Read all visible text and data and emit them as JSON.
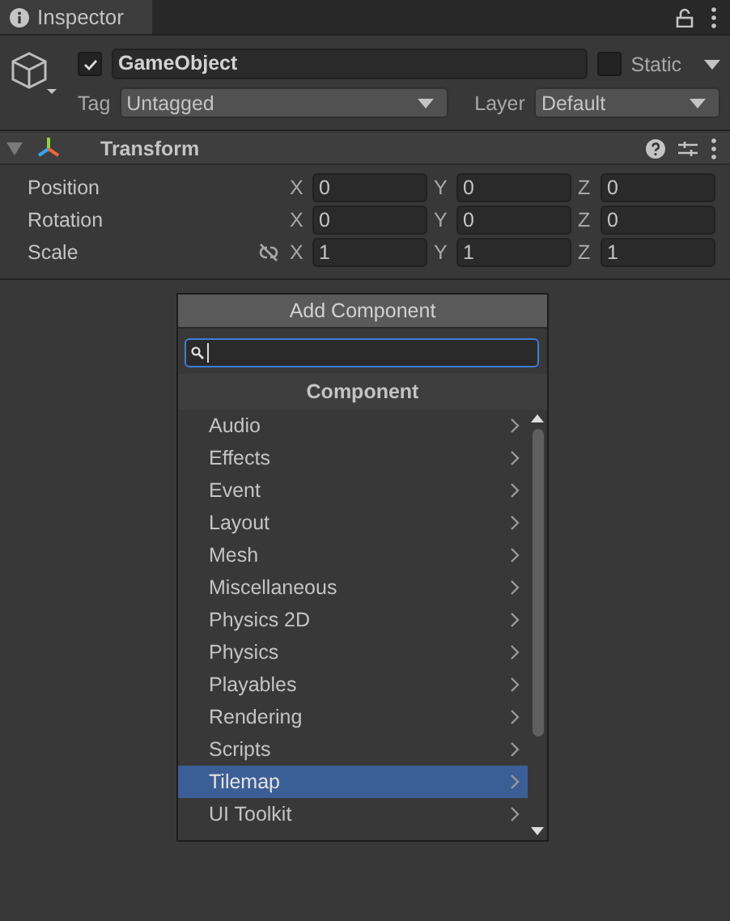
{
  "tabs": [
    {
      "label": "Inspector",
      "selected": true
    }
  ],
  "object": {
    "active": true,
    "name": "GameObject",
    "static": false,
    "static_label": "Static",
    "tag_label": "Tag",
    "tag": "Untagged",
    "layer_label": "Layer",
    "layer": "Default"
  },
  "transform": {
    "title": "Transform",
    "expanded": true,
    "rows": [
      {
        "label": "Position",
        "kind": "plain",
        "fields": [
          {
            "axis": "X",
            "value": "0"
          },
          {
            "axis": "Y",
            "value": "0"
          },
          {
            "axis": "Z",
            "value": "0"
          }
        ]
      },
      {
        "label": "Rotation",
        "kind": "plain",
        "fields": [
          {
            "axis": "X",
            "value": "0"
          },
          {
            "axis": "Y",
            "value": "0"
          },
          {
            "axis": "Z",
            "value": "0"
          }
        ]
      },
      {
        "label": "Scale",
        "kind": "linkable",
        "fields": [
          {
            "axis": "X",
            "value": "1"
          },
          {
            "axis": "Y",
            "value": "1"
          },
          {
            "axis": "Z",
            "value": "1"
          }
        ]
      }
    ]
  },
  "add_component": {
    "button": "Add Component",
    "header": "Component",
    "items": [
      {
        "label": "Audio",
        "selected": false
      },
      {
        "label": "Effects",
        "selected": false
      },
      {
        "label": "Event",
        "selected": false
      },
      {
        "label": "Layout",
        "selected": false
      },
      {
        "label": "Mesh",
        "selected": false
      },
      {
        "label": "Miscellaneous",
        "selected": false
      },
      {
        "label": "Physics 2D",
        "selected": false
      },
      {
        "label": "Physics",
        "selected": false
      },
      {
        "label": "Playables",
        "selected": false
      },
      {
        "label": "Rendering",
        "selected": false
      },
      {
        "label": "Scripts",
        "selected": false
      },
      {
        "label": "Tilemap",
        "selected": true
      },
      {
        "label": "UI Toolkit",
        "selected": false
      }
    ]
  }
}
